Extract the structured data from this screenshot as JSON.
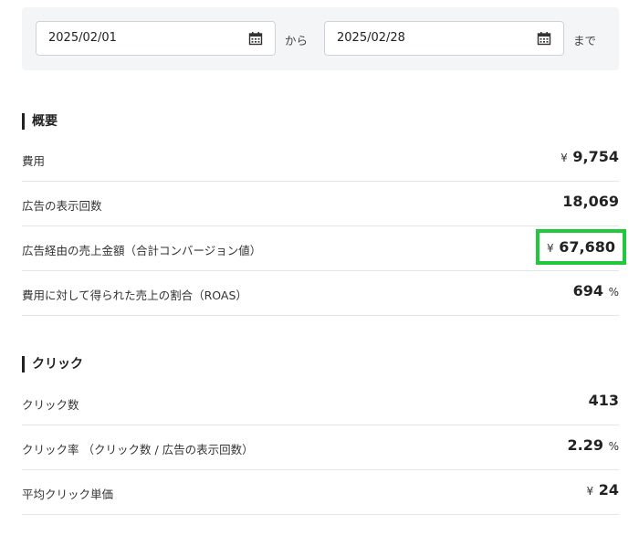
{
  "date_range": {
    "start_date": "2025/02/01",
    "from_word": "から",
    "end_date": "2025/02/28",
    "to_word": "まで"
  },
  "summary": {
    "title": "概要",
    "rows": [
      {
        "label": "費用",
        "currency": "¥",
        "value": "9,754"
      },
      {
        "label": "広告の表示回数",
        "value": "18,069"
      },
      {
        "label": "広告経由の売上金額（合計コンバージョン値）",
        "currency": "¥",
        "value": "67,680"
      },
      {
        "label": "費用に対して得られた売上の割合（ROAS）",
        "value": "694",
        "unit": "%"
      }
    ]
  },
  "clicks": {
    "title": "クリック",
    "rows": [
      {
        "label": "クリック数",
        "value": "413"
      },
      {
        "label": "クリック率 （クリック数 / 広告の表示回数）",
        "value": "2.29",
        "unit": "%"
      },
      {
        "label": "平均クリック単価",
        "currency": "¥",
        "value": "24"
      }
    ]
  },
  "colors": {
    "highlight_border": "#22c83c",
    "panel_background": "#f4f5f7",
    "divider": "#e3e5e8"
  },
  "icons": {
    "date_picker": "calendar-icon"
  }
}
